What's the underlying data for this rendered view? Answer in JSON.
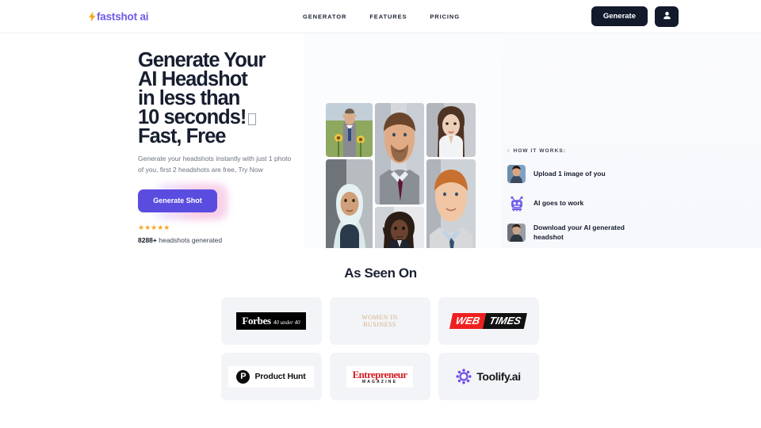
{
  "nav": {
    "logo_text": "fastshot ai",
    "logo_icon": "lightning-bolt-icon",
    "links": [
      {
        "label": "GENERATOR"
      },
      {
        "label": "FEATURES"
      },
      {
        "label": "PRICING"
      }
    ],
    "generate_label": "Generate",
    "account_icon": "user-avatar-icon"
  },
  "hero": {
    "title_lines": [
      "Generate Your",
      "AI Headshot",
      "in less than",
      "10 seconds!",
      "Fast, Free"
    ],
    "title_glyph": "missing-emoji-glyph",
    "subtitle": "Generate your headshots instantly with just 1 photo of you, first 2 headshots are free, Try Now",
    "cta_label": "Generate Shot",
    "cta_color": "#5b4ce0",
    "stars": "★★★★★",
    "star_color": "#f5a623",
    "count": "8288+",
    "count_suffix": " headshots generated",
    "gallery": [
      {
        "name": "headshot-man-sunflower-field"
      },
      {
        "name": "headshot-woman-hijab"
      },
      {
        "name": "headshot-man-suit-burgundy-tie"
      },
      {
        "name": "headshot-woman-braids"
      },
      {
        "name": "headshot-woman-asian-white-coat"
      },
      {
        "name": "headshot-man-ginger-blue-tie"
      }
    ]
  },
  "how_it_works": {
    "label": "HOW IT WORKS:",
    "chevron_icon": "chevron-right-icon",
    "steps": [
      {
        "icon": "photo-upload-thumbnail",
        "text": "Upload 1 image of you"
      },
      {
        "icon": "robot-icon",
        "text": "AI goes to work"
      },
      {
        "icon": "generated-headshot-thumbnail",
        "text": "Download your AI generated headshot"
      }
    ]
  },
  "as_seen_on": {
    "title": "As Seen On",
    "logos": [
      {
        "name": "forbes-logo",
        "primary": "Forbes",
        "secondary": "40 under 40"
      },
      {
        "name": "women-in-business-logo",
        "primary": "WOMEN IN",
        "secondary": "BUSINESS"
      },
      {
        "name": "web-times-logo",
        "primary": "WEB",
        "secondary": "TIMES"
      },
      {
        "name": "product-hunt-logo",
        "primary": "P",
        "secondary": "Product Hunt"
      },
      {
        "name": "entrepreneur-logo",
        "primary": "Entrepreneur",
        "secondary": "MAGAZINE"
      },
      {
        "name": "toolify-logo",
        "primary": "Toolify.ai",
        "secondary": ""
      }
    ]
  }
}
